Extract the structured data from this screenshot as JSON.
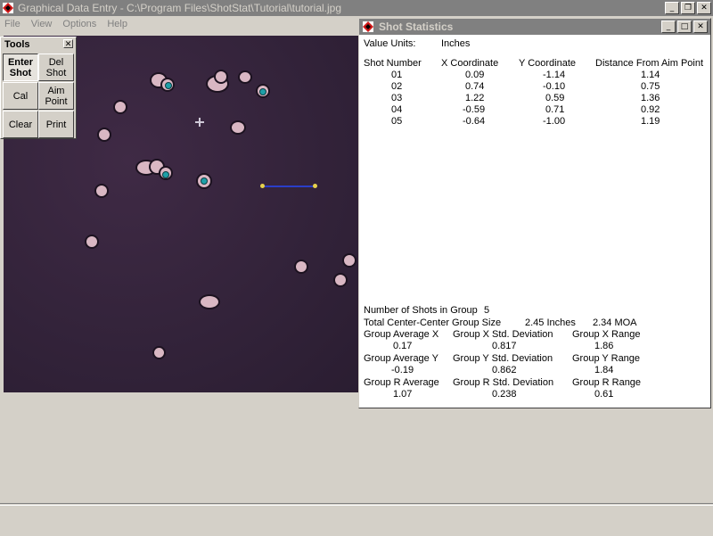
{
  "app": {
    "title": "Graphical Data Entry - C:\\Program Files\\ShotStat\\Tutorial\\tutorial.jpg"
  },
  "menu": [
    "File",
    "View",
    "Options",
    "Help"
  ],
  "tools": {
    "title": "Tools",
    "buttons": {
      "enter_shot": "Enter\nShot",
      "del_shot": "Del\nShot",
      "cal": "Cal",
      "aim_point": "Aim\nPoint",
      "clear": "Clear",
      "print": "Print"
    }
  },
  "stats": {
    "title": "Shot Statistics",
    "value_units_label": "Value Units:",
    "value_units": "Inches",
    "columns": [
      "Shot Number",
      "X Coordinate",
      "Y Coordinate",
      "Distance From Aim Point"
    ],
    "rows": [
      [
        "01",
        "0.09",
        "-1.14",
        "1.14"
      ],
      [
        "02",
        "0.74",
        "-0.10",
        "0.75"
      ],
      [
        "03",
        "1.22",
        "0.59",
        "1.36"
      ],
      [
        "04",
        "-0.59",
        "0.71",
        "0.92"
      ],
      [
        "05",
        "-0.64",
        "-1.00",
        "1.19"
      ]
    ],
    "num_shots_label": "Number of Shots in Group",
    "num_shots": "5",
    "group_size_label": "Total Center-Center Group Size",
    "group_size_inches": "2.45 Inches",
    "group_size_moa": "2.34 MOA",
    "summary": [
      {
        "label": "Group Average X",
        "value": "0.17"
      },
      {
        "label": "Group X Std. Deviation",
        "value": "0.817"
      },
      {
        "label": "Group X Range",
        "value": "1.86"
      },
      {
        "label": "Group Average Y",
        "value": "-0.19"
      },
      {
        "label": "Group Y Std. Deviation",
        "value": "0.862"
      },
      {
        "label": "Group Y Range",
        "value": "1.84"
      },
      {
        "label": "Group R Average",
        "value": "1.07"
      },
      {
        "label": "Group R Std. Deviation",
        "value": "0.238"
      },
      {
        "label": "Group R Range",
        "value": "0.61"
      }
    ]
  },
  "icons": {
    "app": "red-diamond-icon",
    "minimize": "minimize-icon",
    "restore": "restore-icon",
    "maximize": "maximize-icon",
    "close": "close-icon"
  },
  "colors": {
    "titlebar_inactive": "#808080",
    "target_background": "#33233a",
    "shot_marker": "#1ea0a8",
    "calibration_line": "#2a3ec8"
  }
}
